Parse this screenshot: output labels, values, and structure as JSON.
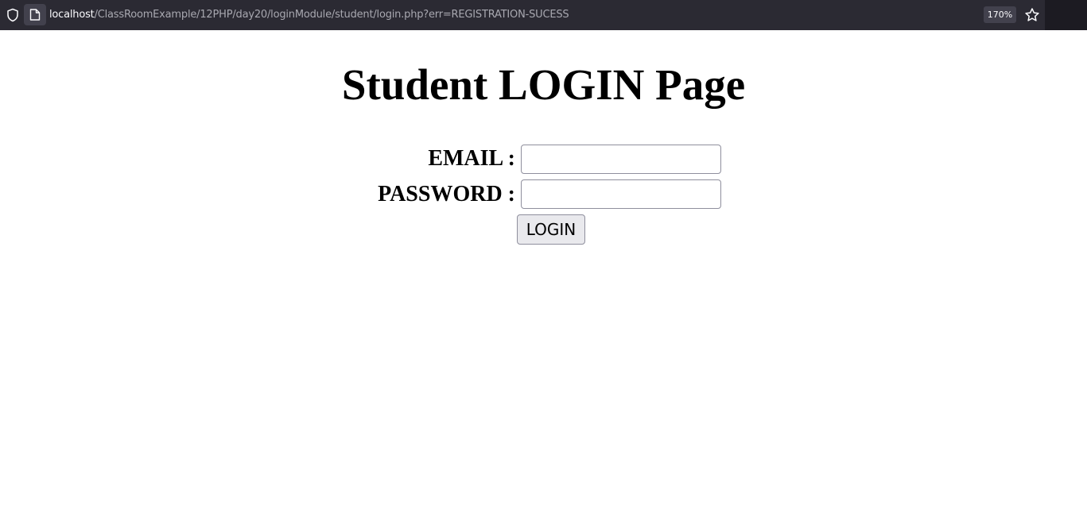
{
  "browser": {
    "url_host": "localhost",
    "url_path": "/ClassRoomExample/12PHP/day20/loginModule/student/login.php?err=REGISTRATION-SUCESS",
    "zoom": "170%",
    "icons": [
      "shield-icon",
      "page-icon",
      "star-icon"
    ]
  },
  "page": {
    "title": "Student LOGIN Page",
    "email_label": "EMAIL :",
    "email_value": "",
    "password_label": "PASSWORD :",
    "password_value": "",
    "login_button": "LOGIN"
  },
  "colors": {
    "toolbar_bg": "#1c1b22",
    "url_field_bg": "#2b2a33",
    "page_bg": "#ffffff",
    "button_bg": "#e9e9ed"
  }
}
